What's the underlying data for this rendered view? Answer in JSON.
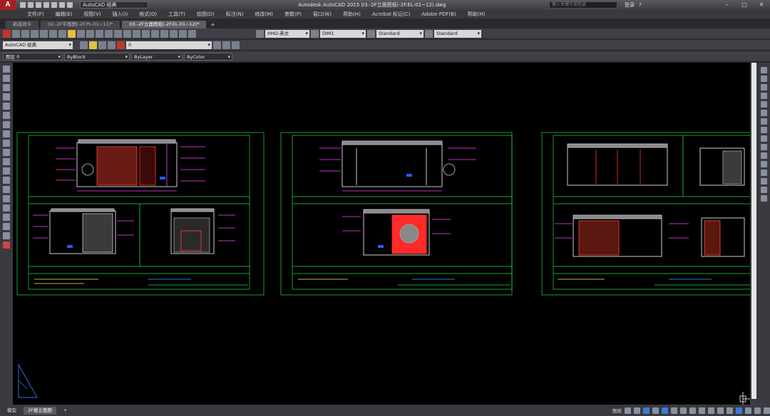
{
  "titlebar": {
    "logo": "A",
    "workspace": "AutoCAD 经典",
    "title": "Autodesk AutoCAD 2015    03.-2F立面图纸(-2F.EL-01~12).dwg",
    "search_placeholder": "键入关键字或短语",
    "user": "登录",
    "help": "?"
  },
  "menu": [
    "文件(F)",
    "编辑(E)",
    "视图(V)",
    "插入(I)",
    "格式(O)",
    "工具(T)",
    "绘图(D)",
    "标注(N)",
    "修改(M)",
    "参数(P)",
    "窗口(W)",
    "帮助(H)",
    "Acrobat 标记(C)",
    "Adobe PDF(B)",
    "帮助(H)"
  ],
  "tabs": [
    {
      "label": "新选项卡"
    },
    {
      "label": "02.-2F平面图(-2F.PL-01~11)*"
    },
    {
      "label": "03.-2F立面图纸(-2F.EL-01~12)*"
    }
  ],
  "toolbar1": {
    "text_style": "HHD-英文",
    "dim_style": "DIM1",
    "table_style": "Standard",
    "mleader_style": "Standard"
  },
  "toolbar2": {
    "workspace": "AutoCAD 经典",
    "layer": "0"
  },
  "toolbar3": {
    "layer_state": "图层 0",
    "linetype": "ByBlock",
    "lineweight": "ByLayer",
    "color": "ByColor"
  },
  "layout_tabs": [
    "模型",
    "2F楼立面图"
  ],
  "colors": {
    "frame": "#22dd44",
    "dim": "#ff44ff",
    "wall": "#ffffff",
    "accent": "#ff2a2a",
    "hatch": "#ffee44"
  }
}
